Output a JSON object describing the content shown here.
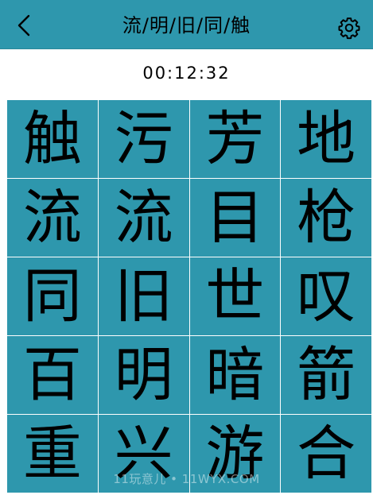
{
  "header": {
    "title": "流/明/旧/同/触",
    "back_icon": "chevron-left-icon",
    "settings_icon": "gear-icon"
  },
  "timer": "00:12:32",
  "board": {
    "cells": [
      "触",
      "污",
      "芳",
      "地",
      "流",
      "流",
      "目",
      "枪",
      "同",
      "旧",
      "世",
      "叹",
      "百",
      "明",
      "暗",
      "箭",
      "重",
      "兴",
      "游",
      "合"
    ]
  },
  "watermark": "11玩意儿 • 11WYX.COM",
  "colors": {
    "accent": "#2e97ad",
    "text": "#000000",
    "background": "#ffffff"
  }
}
